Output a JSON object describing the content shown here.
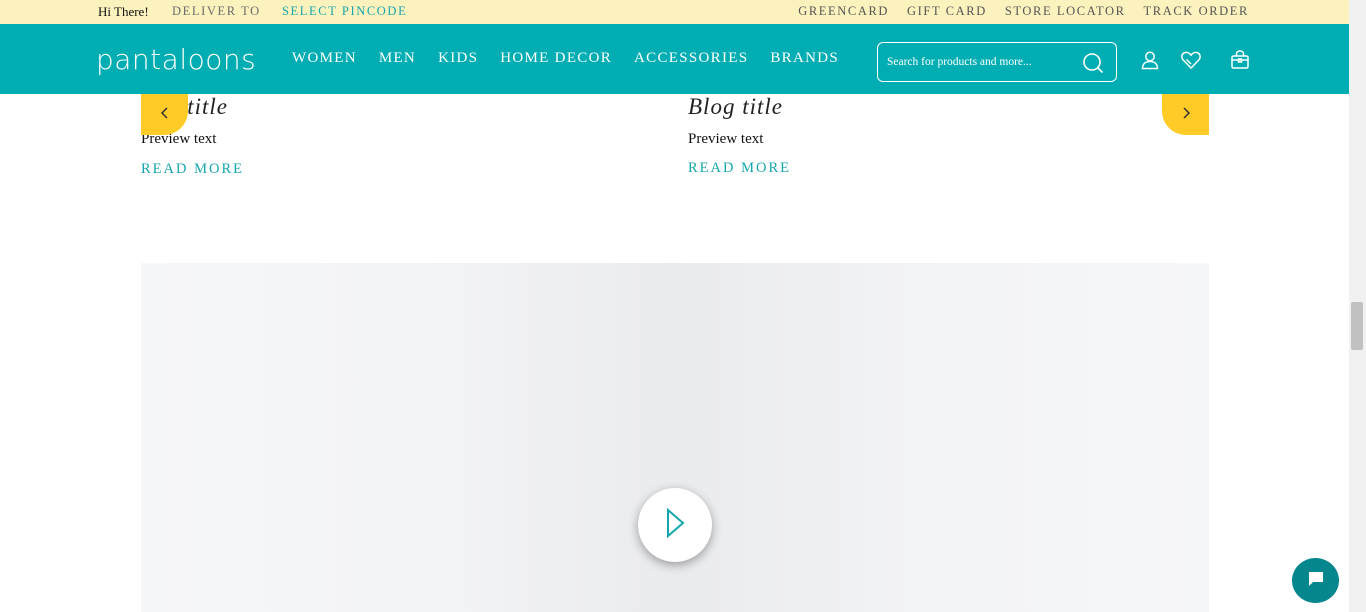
{
  "topbar": {
    "greeting": "Hi There!",
    "deliver_label": "DELIVER TO",
    "pincode_link": "SELECT PINCODE",
    "links": [
      "GREENCARD",
      "GIFT CARD",
      "STORE LOCATOR",
      "TRACK ORDER"
    ]
  },
  "header": {
    "logo": "pantaloons",
    "nav": [
      "WOMEN",
      "MEN",
      "KIDS",
      "HOME DECOR",
      "ACCESSORIES",
      "BRANDS"
    ],
    "search_placeholder": "Search for products and more..."
  },
  "blogs": [
    {
      "title": "g title",
      "preview": "Preview text",
      "cta": "READ MORE"
    },
    {
      "title": "Blog title",
      "preview": "Preview text",
      "cta": "READ MORE"
    }
  ],
  "colors": {
    "topbar_bg": "#fbf2bd",
    "brand_teal": "#00adb2",
    "accent_yellow": "#ffcb27",
    "link_teal": "#16a6ad",
    "chat_bg": "#06868d"
  },
  "icons": [
    "search-icon",
    "user-icon",
    "heart-icon",
    "bag-icon",
    "chevron-left-icon",
    "chevron-right-icon",
    "play-icon",
    "chat-icon"
  ]
}
